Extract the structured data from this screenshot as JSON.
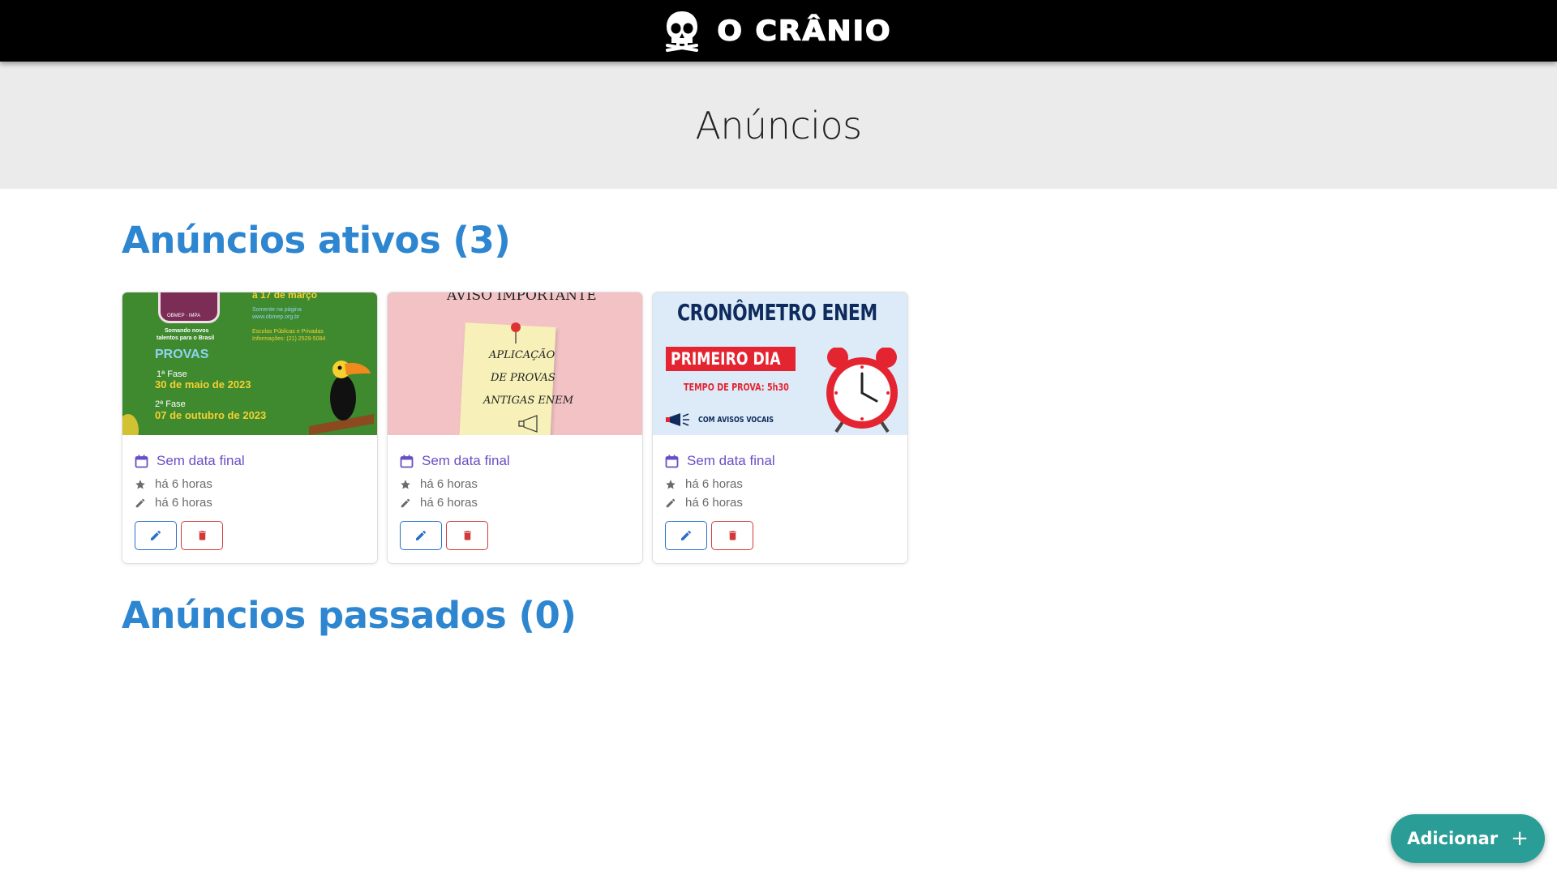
{
  "header": {
    "brand_text": "O CRÂNIO",
    "logo_icon": "skull-icon"
  },
  "hero": {
    "title": "Anúncios"
  },
  "sections": {
    "active_title": "Anúncios ativos (3)",
    "past_title": "Anúncios passados (0)"
  },
  "cards": [
    {
      "image": {
        "lines": [
          "a 17 de março",
          "Somente na página",
          "www.obmep.org.br",
          "Escolas Públicas e Privadas",
          "Informações: (21) 2529-5084",
          "Somando novos",
          "talentos para o Brasil",
          "PROVAS",
          "1ª Fase",
          "30 de maio de 2023",
          "2ª Fase",
          "07 de outubro de 2023",
          "OBMEP · IMPA"
        ],
        "bg": "#3f8a2f"
      },
      "end_date": "Sem data final",
      "created": "há 6 horas",
      "edited": "há 6 horas"
    },
    {
      "image": {
        "lines": [
          "AVISO IMPORTANTE",
          "APLICAÇÃO",
          "DE PROVAS",
          "ANTIGAS ENEM"
        ],
        "bg": "#f2c2c5"
      },
      "end_date": "Sem data final",
      "created": "há 6 horas",
      "edited": "há 6 horas"
    },
    {
      "image": {
        "lines": [
          "CRONÔMETRO ENEM",
          "PRIMEIRO DIA",
          "TEMPO DE PROVA: 5h30",
          "COM AVISOS VOCAIS"
        ],
        "bg": "#dcebf7"
      },
      "end_date": "Sem data final",
      "created": "há 6 horas",
      "edited": "há 6 horas"
    }
  ],
  "fab": {
    "label": "Adicionar",
    "icon": "plus-icon"
  },
  "colors": {
    "heading_blue": "#2e86d1",
    "end_date_purple": "#6a4fc4",
    "edit_blue": "#2a6fc9",
    "delete_red": "#d23a3a",
    "fab_teal": "#2a9d96"
  }
}
